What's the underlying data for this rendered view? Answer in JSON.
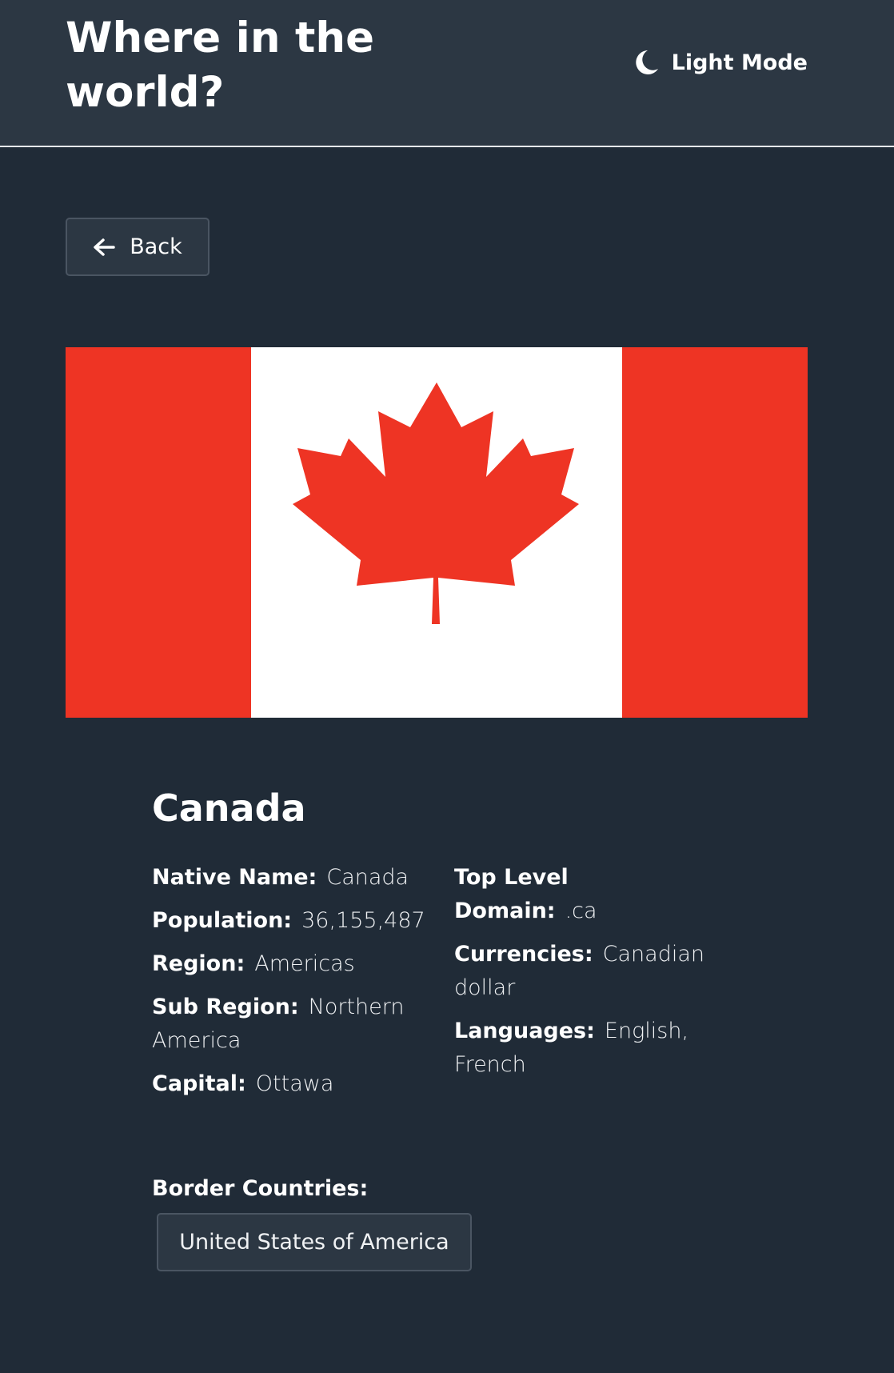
{
  "header": {
    "title": "Where in the world?",
    "mode_toggle_label": "Light Mode",
    "mode_icon": "moon-icon"
  },
  "back_button": {
    "label": "Back",
    "icon": "arrow-left-icon"
  },
  "flag": {
    "icon": "canada-flag",
    "colors": {
      "red": "#ee3424",
      "white": "#ffffff"
    }
  },
  "country": {
    "name": "Canada",
    "details_left": [
      {
        "label": "Native Name:",
        "value": "Canada"
      },
      {
        "label": "Population:",
        "value": "36,155,487"
      },
      {
        "label": "Region:",
        "value": "Americas"
      },
      {
        "label": "Sub Region:",
        "value": "Northern America"
      },
      {
        "label": "Capital:",
        "value": "Ottawa"
      }
    ],
    "details_right": [
      {
        "label": "Top Level Domain:",
        "value": ".ca"
      },
      {
        "label": "Currencies:",
        "value": "Canadian dollar"
      },
      {
        "label": "Languages:",
        "value": "English, French"
      }
    ],
    "border_countries_label": "Border Countries:",
    "border_countries": [
      "United States of America"
    ]
  },
  "theme": {
    "background": "#202b37",
    "elements": "#2c3743",
    "text": "#ffffff"
  }
}
